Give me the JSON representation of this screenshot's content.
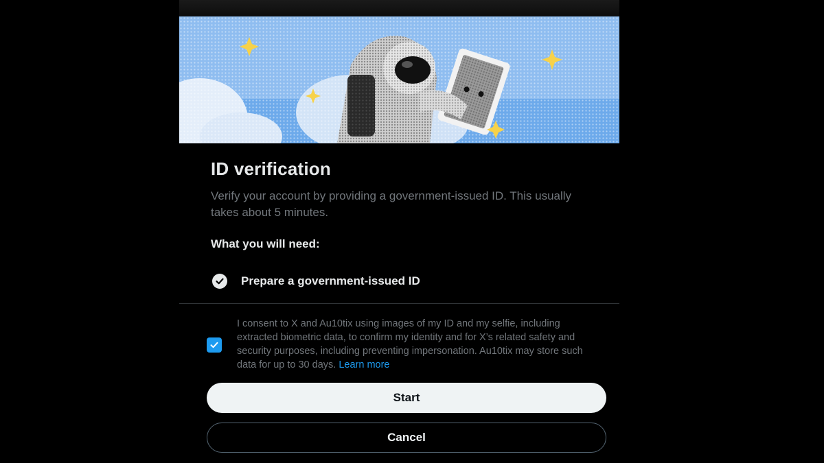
{
  "dialog": {
    "title": "ID verification",
    "subtitle": "Verify your account by providing a government-issued ID. This usually takes about 5 minutes.",
    "requirements_heading": "What you will need:",
    "requirements": [
      {
        "label": "Prepare a government-issued ID",
        "icon": "check-circle-icon"
      }
    ],
    "consent": {
      "checked": true,
      "text": "I consent to X and Au10tix using images of my ID and my selfie, including extracted biometric data, to confirm my identity and for X’s related safety and security purposes, including preventing impersonation. Au10tix may store such data for up to 30 days.",
      "link_label": "Learn more"
    },
    "buttons": {
      "start_label": "Start",
      "cancel_label": "Cancel"
    },
    "banner_image": "astronaut-with-laptop-illustration"
  },
  "colors": {
    "background": "#000000",
    "text_primary": "#e7e9ea",
    "text_secondary": "#71767b",
    "accent": "#1d9bf0",
    "start_button_bg": "#eff3f4",
    "divider": "#2f3336"
  }
}
